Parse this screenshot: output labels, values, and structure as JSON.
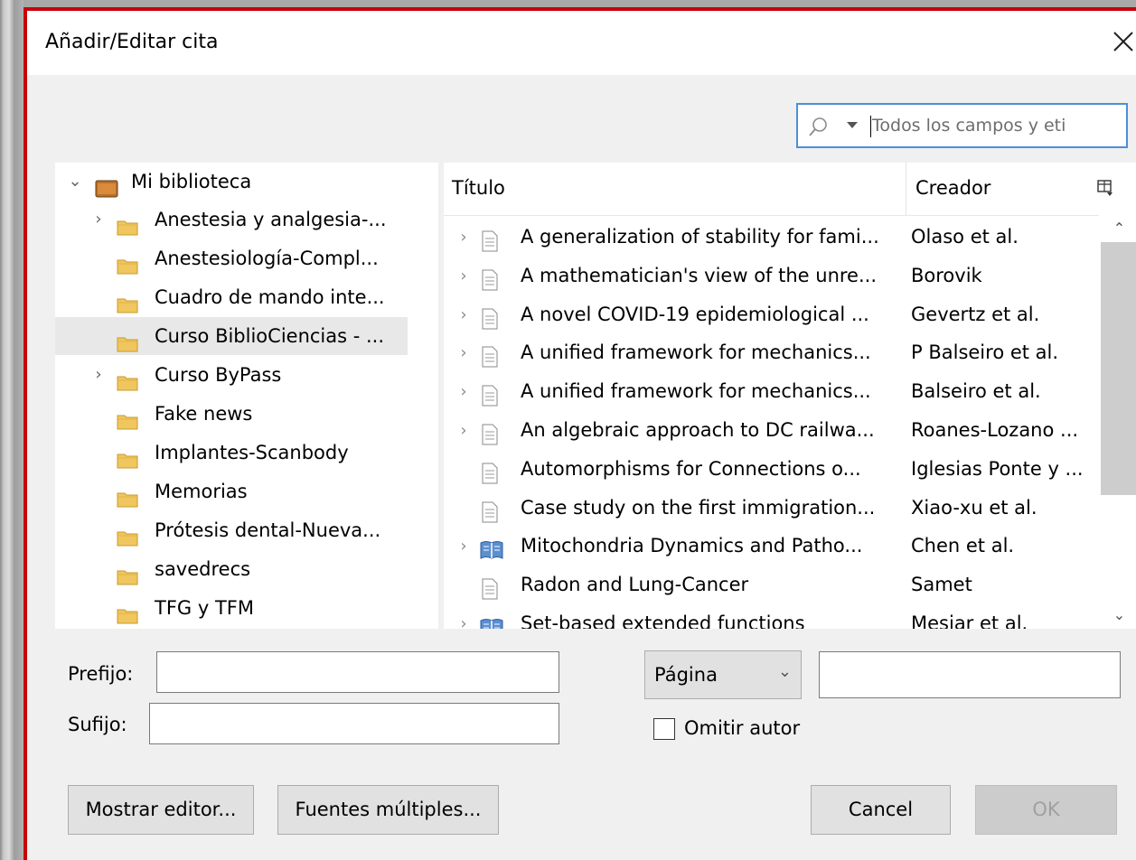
{
  "dialog": {
    "title": "Añadir/Editar cita"
  },
  "search": {
    "placeholder": "Todos los campos y eti"
  },
  "tree": {
    "root": "Mi biblioteca",
    "items": [
      {
        "label": "Anestesia y analgesia-...",
        "expandable": true
      },
      {
        "label": "Anestesiología-Compl...",
        "expandable": false
      },
      {
        "label": "Cuadro de mando inte...",
        "expandable": false
      },
      {
        "label": "Curso BiblioCiencias - ...",
        "expandable": false,
        "selected": true
      },
      {
        "label": "Curso ByPass",
        "expandable": true
      },
      {
        "label": "Fake news",
        "expandable": false
      },
      {
        "label": "Implantes-Scanbody",
        "expandable": false
      },
      {
        "label": "Memorias",
        "expandable": false
      },
      {
        "label": "Prótesis dental-Nueva...",
        "expandable": false
      },
      {
        "label": "savedrecs",
        "expandable": false
      },
      {
        "label": "TFG y TFM",
        "expandable": false
      }
    ]
  },
  "items_table": {
    "columns": {
      "title": "Título",
      "creator": "Creador"
    },
    "rows": [
      {
        "title": "A generalization of stability for fami...",
        "creator": "Olaso et al.",
        "expandable": true,
        "icon": "document-icon"
      },
      {
        "title": "A mathematician's view of the unre...",
        "creator": "Borovik",
        "expandable": true,
        "icon": "document-icon"
      },
      {
        "title": "A novel COVID-19 epidemiological ...",
        "creator": "Gevertz et al.",
        "expandable": true,
        "icon": "document-icon"
      },
      {
        "title": "A unified framework for mechanics...",
        "creator": "P Balseiro et al.",
        "expandable": true,
        "icon": "document-icon"
      },
      {
        "title": "A unified framework for mechanics...",
        "creator": "Balseiro et al.",
        "expandable": true,
        "icon": "document-icon"
      },
      {
        "title": "An algebraic approach to DC railwa...",
        "creator": "Roanes-Lozano ...",
        "expandable": true,
        "icon": "document-icon"
      },
      {
        "title": "Automorphisms for Connections o...",
        "creator": "Iglesias Ponte y ...",
        "expandable": false,
        "icon": "document-icon"
      },
      {
        "title": "Case study on the first immigration...",
        "creator": "Xiao-xu et al.",
        "expandable": false,
        "icon": "document-icon"
      },
      {
        "title": "Mitochondria Dynamics and Patho...",
        "creator": "Chen et al.",
        "expandable": true,
        "icon": "book-icon"
      },
      {
        "title": "Radon and Lung-Cancer",
        "creator": "Samet",
        "expandable": false,
        "icon": "document-icon"
      },
      {
        "title": "Set-based extended functions",
        "creator": "Mesiar et al.",
        "expandable": true,
        "icon": "book-icon"
      }
    ]
  },
  "form": {
    "prefix_label": "Prefijo:",
    "prefix_value": "",
    "suffix_label": "Sufijo:",
    "suffix_value": "",
    "locator_select": "Página",
    "locator_value": "",
    "omit_author_label": "Omitir autor"
  },
  "buttons": {
    "show_editor": "Mostrar editor...",
    "multiple_sources": "Fuentes múltiples...",
    "cancel": "Cancel",
    "ok": "OK"
  },
  "colors": {
    "dialog_border": "#c8000a",
    "search_border": "#4a90d9",
    "folder": "#f0c75e"
  }
}
